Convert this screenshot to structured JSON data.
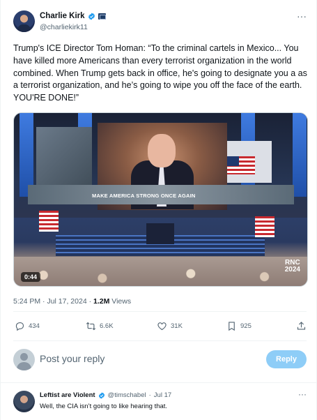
{
  "author": {
    "name": "Charlie Kirk",
    "handle": "@charliekirk11"
  },
  "menu_glyph": "···",
  "tweet": {
    "text": "Trump's ICE Director Tom Homan: “To the criminal cartels in Mexico... You have killed more Americans than every terrorist organization in the world combined. When Trump gets back in office, he's going to designate you a as a terrorist organization, and he’s going to wipe you off the face of the earth. YOU'RE DONE!”"
  },
  "media": {
    "banner_text": "MAKE AMERICA STRONG ONCE AGAIN",
    "logo_line1": "RNC",
    "logo_line2": "2024",
    "duration": "0:44"
  },
  "meta": {
    "time": "5:24 PM",
    "separator": "·",
    "date": "Jul 17, 2024",
    "views_count": "1.2M",
    "views_label": "Views"
  },
  "actions": {
    "replies": "434",
    "reposts": "6.6K",
    "likes": "31K",
    "bookmarks": "925"
  },
  "composer": {
    "placeholder": "Post your reply",
    "button_label": "Reply"
  },
  "reply": {
    "name": "Leftist are Violent",
    "handle": "@timschabel",
    "separator": "·",
    "date": "Jul 17",
    "text": "Well, the CIA isn’t going to like hearing that."
  },
  "colors": {
    "verified_blue": "#1d9bf0",
    "reply_button": "#8ecdf7",
    "secondary_text": "#536471"
  }
}
